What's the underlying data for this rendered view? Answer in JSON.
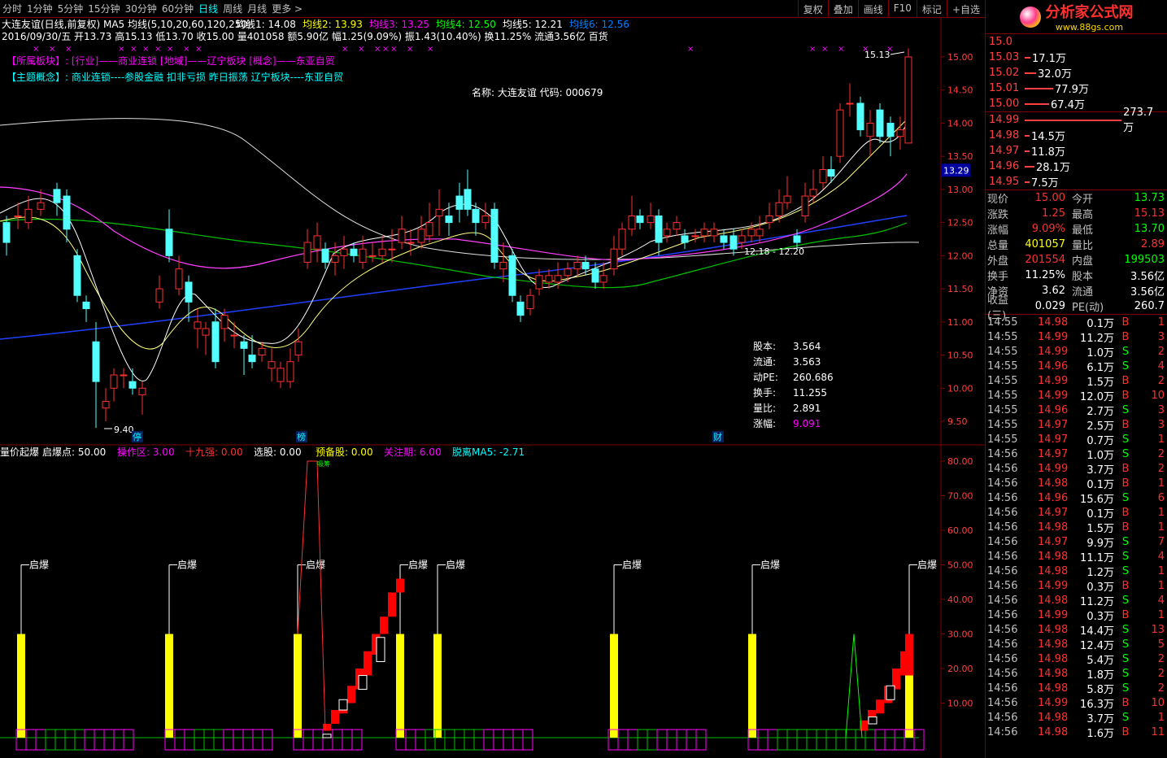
{
  "toolbar": {
    "items": [
      "分时",
      "1分钟",
      "5分钟",
      "15分钟",
      "30分钟",
      "60分钟",
      "日线",
      "周线",
      "月线",
      "更多 >"
    ],
    "active": "日线",
    "right": [
      "复权",
      "叠加",
      "画线",
      "F10",
      "标记",
      "+自选"
    ]
  },
  "header": {
    "line1": "大连友谊(日线,前复权) MA5 均线(5,10,20,60,120,250)",
    "ma": [
      {
        "label": "均线1: 14.08",
        "color": "#ffffff"
      },
      {
        "label": "均线2: 13.93",
        "color": "#ffff00"
      },
      {
        "label": "均线3: 13.25",
        "color": "#ff00ff"
      },
      {
        "label": "均线4: 12.50",
        "color": "#00ff00"
      },
      {
        "label": "均线5: 12.21",
        "color": "#ffffff"
      },
      {
        "label": "均线6: 12.56",
        "color": "#0080ff"
      }
    ],
    "line2": "2016/09/30/五 开13.73 高15.13 低13.70 收15.00 量401058 额5.90亿 幅1.25(9.09%) 振1.43(10.40%) 换11.25% 流通3.56亿 百货",
    "sector": "【所属板块】: [行业]——商业连锁   [地域]——辽宁板块   [概念]——东亚自贸",
    "theme": "【主题概念】: 商业连锁----参股金融 扣非亏损 昨日振荡 辽宁板块----东亚自贸",
    "name": "名称: 大连友谊 代码: 000679"
  },
  "info_box": [
    [
      "股本:",
      "3.564"
    ],
    [
      "流通:",
      "3.563"
    ],
    [
      "动PE:",
      "260.686"
    ],
    [
      "换手:",
      "11.255"
    ],
    [
      "量比:",
      "2.891"
    ],
    [
      "涨幅:",
      "9.091"
    ]
  ],
  "annotations": {
    "high": "15.13",
    "low": "9.40",
    "range": "12.18 - 12.20",
    "last_price_tag": "13.29",
    "markers": [
      "停",
      "榜",
      "财"
    ]
  },
  "indicator": {
    "title": "量价起爆",
    "items": [
      {
        "label": "启爆点: 50.00",
        "color": "#ffffff"
      },
      {
        "label": "操作区: 3.00",
        "color": "#ff00ff"
      },
      {
        "label": "十九强: 0.00",
        "color": "#ff3030"
      },
      {
        "label": "选股: 0.00",
        "color": "#ffffff"
      },
      {
        "label": "预备股: 0.00",
        "color": "#ffff00"
      },
      {
        "label": "关注期: 6.00",
        "color": "#ff00ff"
      },
      {
        "label": "脱离MA5: -2.71",
        "color": "#00ffff"
      }
    ],
    "signal": "启爆"
  },
  "chart_data": {
    "type": "candlestick",
    "price_axis": [
      15.0,
      14.5,
      14.0,
      13.5,
      13.0,
      12.5,
      12.0,
      11.5,
      11.0,
      10.5,
      10.0,
      9.5
    ],
    "indicator_axis": [
      80.0,
      70.0,
      60.0,
      50.0,
      40.0,
      30.0,
      20.0,
      10.0
    ]
  },
  "orderbook": {
    "asks": [
      {
        "p": "15.03",
        "v": "17.1万",
        "b": 0.06
      },
      {
        "p": "15.02",
        "v": "32.0万",
        "b": 0.12
      },
      {
        "p": "15.01",
        "v": "77.9万",
        "b": 0.29
      },
      {
        "p": "15.00",
        "v": "67.4万",
        "b": 0.25
      }
    ],
    "bids": [
      {
        "p": "14.99",
        "v": "273.7万",
        "b": 1.0
      },
      {
        "p": "14.98",
        "v": "14.5万",
        "b": 0.05
      },
      {
        "p": "14.97",
        "v": "11.8万",
        "b": 0.04
      },
      {
        "p": "14.96",
        "v": "28.1万",
        "b": 0.1
      },
      {
        "p": "14.95",
        "v": "7.5万",
        "b": 0.03
      }
    ]
  },
  "quote": [
    {
      "k": "现价",
      "v": "15.00",
      "vc": "red",
      "k2": "今开",
      "v2": "13.73",
      "v2c": "green"
    },
    {
      "k": "涨跌",
      "v": "1.25",
      "vc": "red",
      "k2": "最高",
      "v2": "15.13",
      "v2c": "red"
    },
    {
      "k": "涨幅",
      "v": "9.09%",
      "vc": "red",
      "k2": "最低",
      "v2": "13.70",
      "v2c": "green"
    },
    {
      "k": "总量",
      "v": "401057",
      "vc": "yellow",
      "k2": "量比",
      "v2": "2.89",
      "v2c": "red"
    },
    {
      "k": "外盘",
      "v": "201554",
      "vc": "red",
      "k2": "内盘",
      "v2": "199503",
      "v2c": "green"
    },
    {
      "k": "换手",
      "v": "11.25%",
      "vc": "white",
      "k2": "股本",
      "v2": "3.56亿",
      "v2c": "white"
    },
    {
      "k": "净资",
      "v": "3.62",
      "vc": "white",
      "k2": "流通",
      "v2": "3.56亿",
      "v2c": "white"
    },
    {
      "k": "收益(三)",
      "v": "0.029",
      "vc": "white",
      "k2": "PE(动)",
      "v2": "260.7",
      "v2c": "white"
    }
  ],
  "ticks": [
    [
      "14:55",
      "14.98",
      "0.1万",
      "B",
      "1"
    ],
    [
      "14:55",
      "14.99",
      "11.2万",
      "B",
      "3"
    ],
    [
      "14:55",
      "14.99",
      "1.0万",
      "S",
      "2"
    ],
    [
      "14:55",
      "14.96",
      "6.1万",
      "S",
      "4"
    ],
    [
      "14:55",
      "14.99",
      "1.5万",
      "B",
      "2"
    ],
    [
      "14:55",
      "14.99",
      "12.0万",
      "B",
      "10"
    ],
    [
      "14:55",
      "14.96",
      "2.7万",
      "S",
      "3"
    ],
    [
      "14:55",
      "14.97",
      "2.5万",
      "B",
      "3"
    ],
    [
      "14:55",
      "14.97",
      "0.7万",
      "S",
      "1"
    ],
    [
      "14:56",
      "14.97",
      "1.0万",
      "S",
      "2"
    ],
    [
      "14:56",
      "14.99",
      "3.7万",
      "B",
      "2"
    ],
    [
      "14:56",
      "14.98",
      "0.1万",
      "B",
      "1"
    ],
    [
      "14:56",
      "14.96",
      "15.6万",
      "S",
      "6"
    ],
    [
      "14:56",
      "14.97",
      "0.1万",
      "B",
      "1"
    ],
    [
      "14:56",
      "14.98",
      "1.5万",
      "B",
      "1"
    ],
    [
      "14:56",
      "14.97",
      "9.9万",
      "S",
      "7"
    ],
    [
      "14:56",
      "14.98",
      "11.1万",
      "S",
      "4"
    ],
    [
      "14:56",
      "14.98",
      "1.2万",
      "S",
      "1"
    ],
    [
      "14:56",
      "14.99",
      "0.3万",
      "B",
      "1"
    ],
    [
      "14:56",
      "14.98",
      "11.2万",
      "S",
      "4"
    ],
    [
      "14:56",
      "14.99",
      "0.3万",
      "B",
      "1"
    ],
    [
      "14:56",
      "14.98",
      "14.4万",
      "S",
      "13"
    ],
    [
      "14:56",
      "14.98",
      "12.4万",
      "S",
      "5"
    ],
    [
      "14:56",
      "14.98",
      "5.4万",
      "S",
      "2"
    ],
    [
      "14:56",
      "14.98",
      "1.8万",
      "S",
      "2"
    ],
    [
      "14:56",
      "14.98",
      "5.8万",
      "S",
      "2"
    ],
    [
      "14:56",
      "14.99",
      "16.3万",
      "B",
      "10"
    ],
    [
      "14:56",
      "14.98",
      "3.7万",
      "S",
      "1"
    ],
    [
      "14:56",
      "14.98",
      "1.6万",
      "B",
      "11"
    ]
  ]
}
